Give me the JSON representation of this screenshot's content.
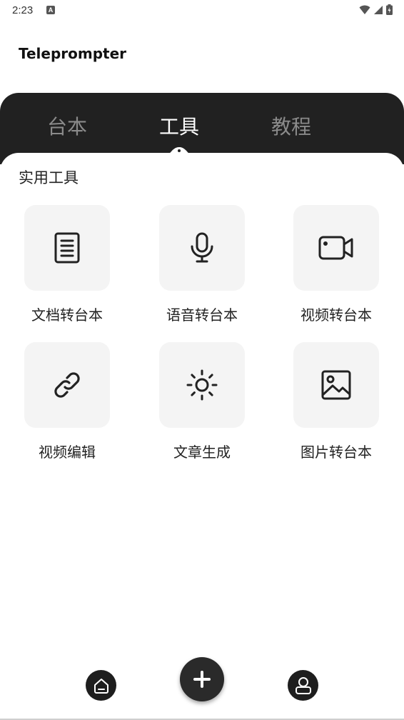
{
  "status_bar": {
    "time": "2:23",
    "notification_letter": "A"
  },
  "app": {
    "title": "Teleprompter"
  },
  "tabs": [
    {
      "label": "台本",
      "active": false
    },
    {
      "label": "工具",
      "active": true
    },
    {
      "label": "教程",
      "active": false
    }
  ],
  "section": {
    "title": "实用工具"
  },
  "tools": [
    {
      "label": "文档转台本",
      "icon": "document-icon"
    },
    {
      "label": "语音转台本",
      "icon": "microphone-icon"
    },
    {
      "label": "视频转台本",
      "icon": "video-camera-icon"
    },
    {
      "label": "视频编辑",
      "icon": "link-icon"
    },
    {
      "label": "文章生成",
      "icon": "sun-icon"
    },
    {
      "label": "图片转台本",
      "icon": "image-icon"
    }
  ],
  "bottom_nav": {
    "left_icon": "home-icon",
    "center_icon": "plus-icon",
    "right_icon": "profile-icon"
  },
  "colors": {
    "tab_bar_bg": "#212121",
    "tab_active": "#ffffff",
    "tab_inactive": "#8a8a8a",
    "tile_bg": "#f4f4f4"
  }
}
